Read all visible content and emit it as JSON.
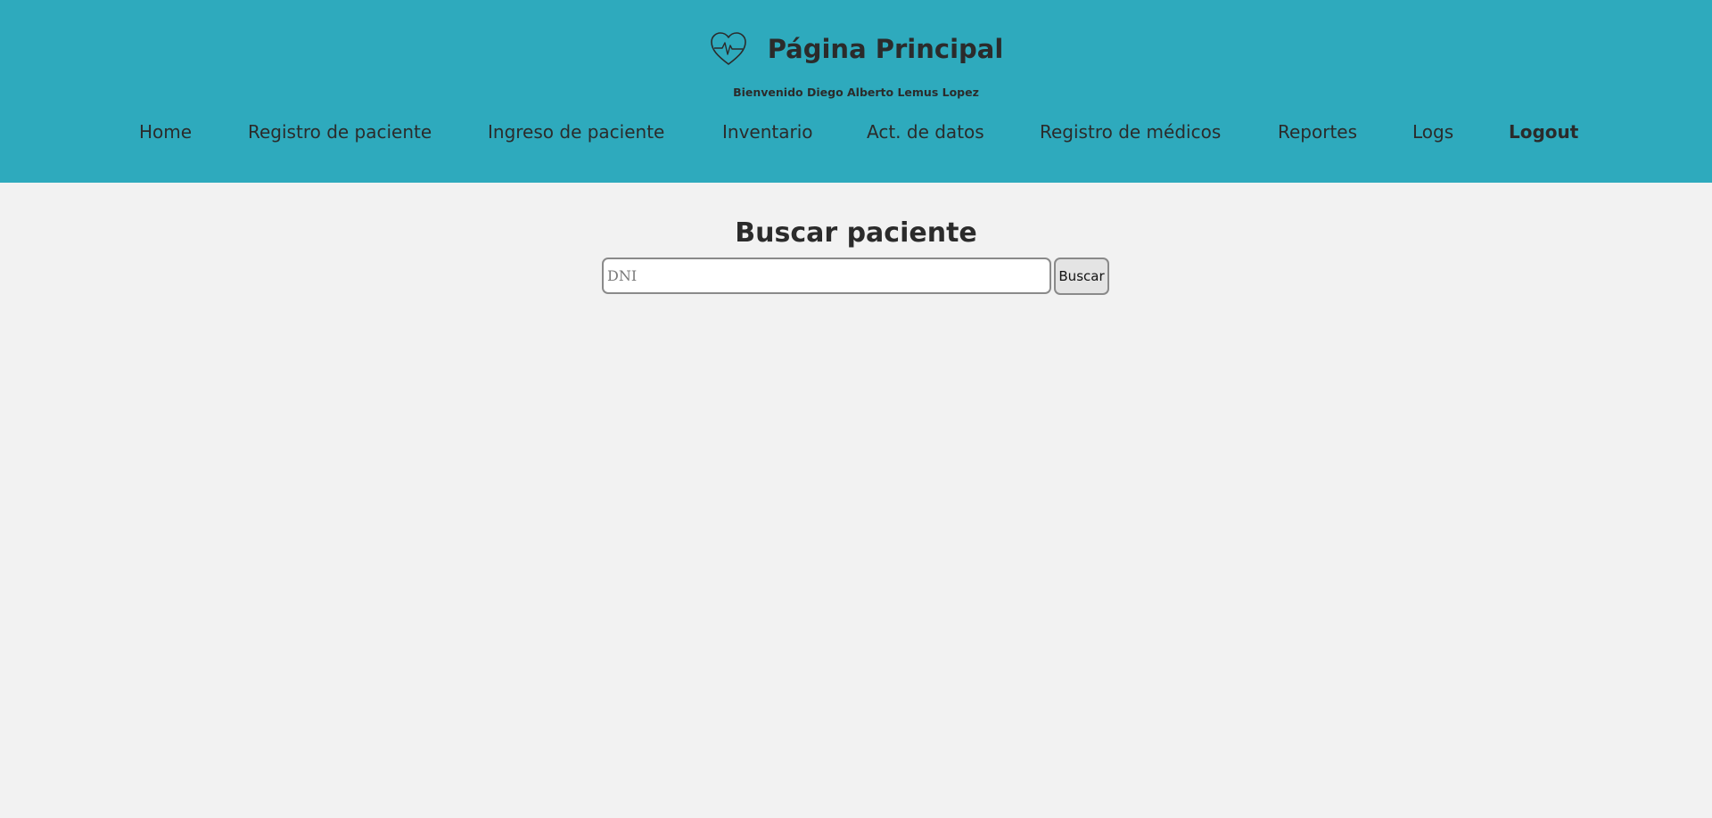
{
  "header": {
    "title": "Página Principal",
    "welcome": "Bienvenido Diego Alberto Lemus Lopez",
    "icon": "heart-pulse-icon",
    "background_color": "#2eaabd"
  },
  "nav": {
    "home": "Home",
    "registro_paciente": "Registro de paciente",
    "ingreso_paciente": "Ingreso de paciente",
    "inventario": "Inventario",
    "act_datos": "Act. de datos",
    "registro_medicos": "Registro de médicos",
    "reportes": "Reportes",
    "logs": "Logs",
    "logout": "Logout"
  },
  "search": {
    "title": "Buscar paciente",
    "placeholder": "DNI",
    "value": "",
    "button_label": "Buscar"
  }
}
